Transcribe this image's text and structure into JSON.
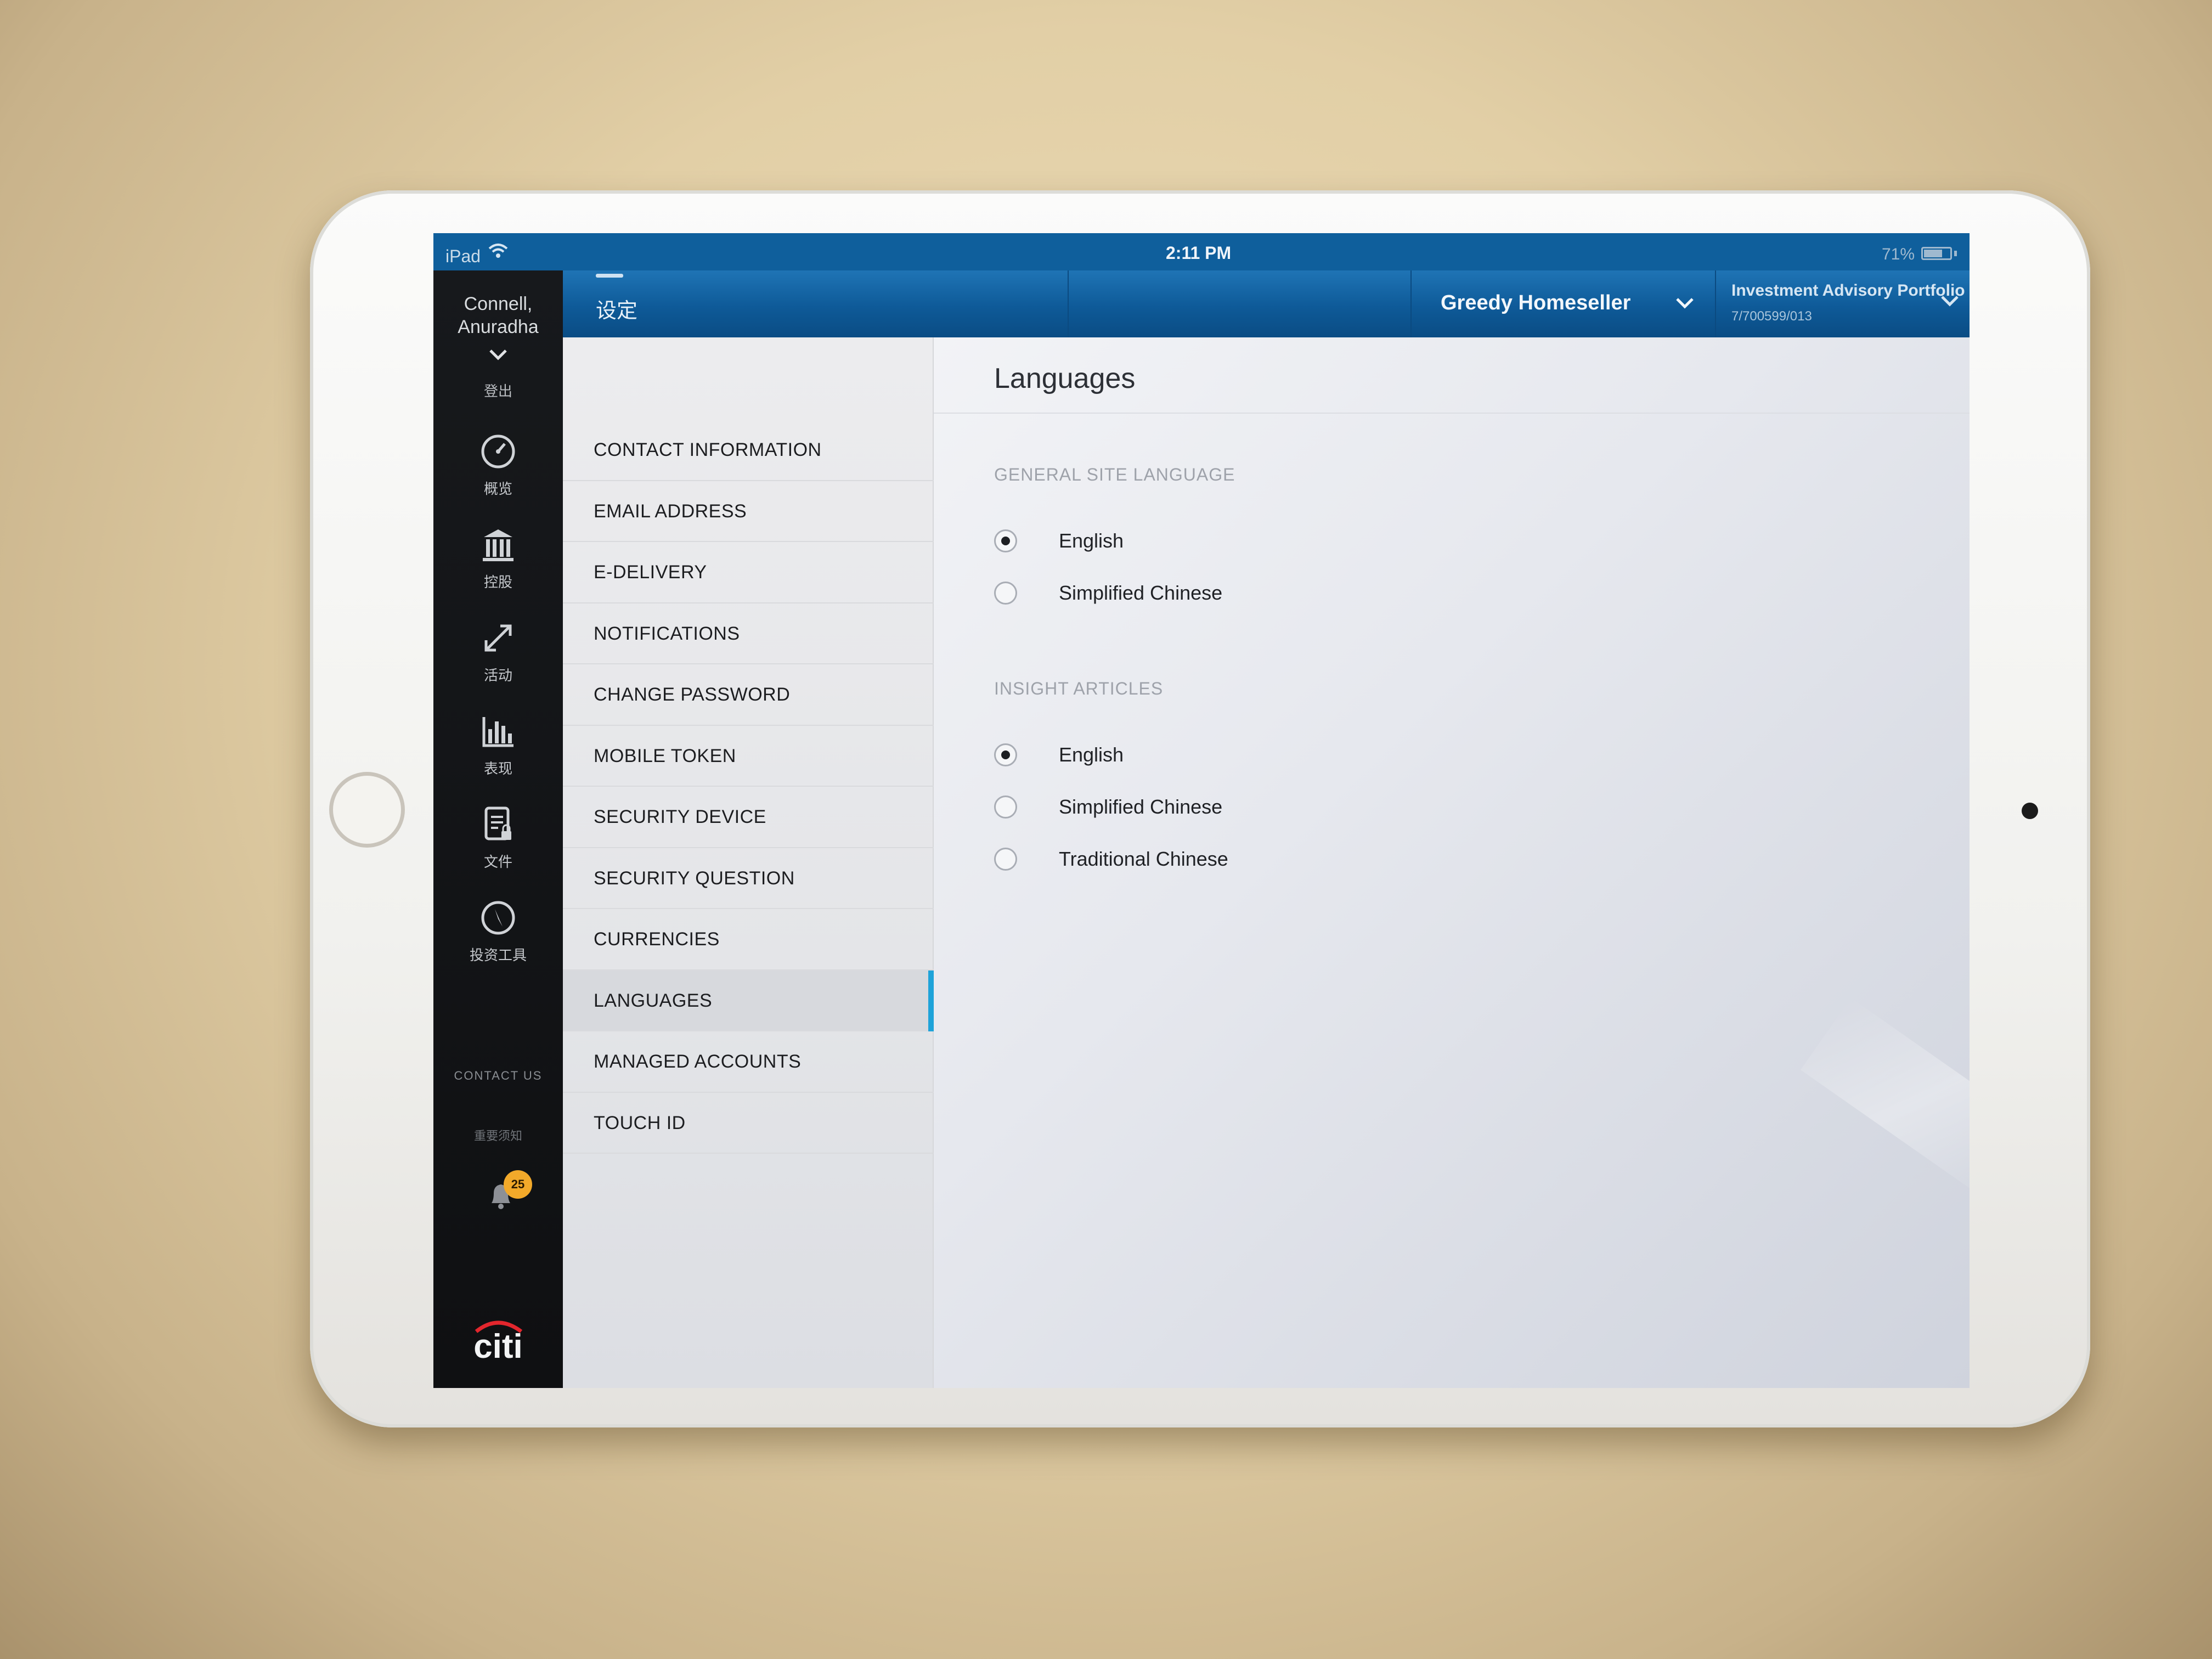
{
  "status_bar": {
    "device": "iPad",
    "time": "2:11 PM",
    "battery_percent": "71%",
    "battery_level": 0.71
  },
  "user": {
    "name_line1": "Connell,",
    "name_line2": "Anuradha",
    "logout_label": "登出"
  },
  "rail": {
    "items": [
      {
        "label": "概览",
        "icon": "gauge-icon"
      },
      {
        "label": "控股",
        "icon": "bank-icon"
      },
      {
        "label": "活动",
        "icon": "arrows-icon"
      },
      {
        "label": "表现",
        "icon": "bar-chart-icon"
      },
      {
        "label": "文件",
        "icon": "document-lock-icon"
      },
      {
        "label": "投资工具",
        "icon": "compass-icon"
      }
    ],
    "contact_us": "CONTACT US",
    "notice": "重要须知",
    "notification_count": "25",
    "logo": "citi"
  },
  "header": {
    "title": "设定",
    "household": "Greedy Homeseller",
    "account_name": "Investment Advisory Portfolio",
    "account_number": "7/700599/013"
  },
  "settings_nav": {
    "items": [
      {
        "label": "CONTACT INFORMATION"
      },
      {
        "label": "EMAIL ADDRESS"
      },
      {
        "label": "E-DELIVERY"
      },
      {
        "label": "NOTIFICATIONS"
      },
      {
        "label": "CHANGE PASSWORD"
      },
      {
        "label": "MOBILE TOKEN"
      },
      {
        "label": "SECURITY DEVICE"
      },
      {
        "label": "SECURITY QUESTION"
      },
      {
        "label": "CURRENCIES"
      },
      {
        "label": "LANGUAGES"
      },
      {
        "label": "MANAGED ACCOUNTS"
      },
      {
        "label": "TOUCH ID"
      }
    ],
    "active": "LANGUAGES"
  },
  "content": {
    "title": "Languages",
    "general_site_language": {
      "label": "GENERAL SITE LANGUAGE",
      "options": [
        "English",
        "Simplified Chinese"
      ],
      "selected": "English"
    },
    "insight_articles": {
      "label": "INSIGHT ARTICLES",
      "options": [
        "English",
        "Simplified Chinese",
        "Traditional Chinese"
      ],
      "selected": "English"
    }
  },
  "colors": {
    "header_blue": "#0e5a98",
    "status_blue": "#0f5f9c",
    "active_indicator": "#1ea3d9",
    "rail_dark": "#141618",
    "badge": "#f2a92a"
  }
}
